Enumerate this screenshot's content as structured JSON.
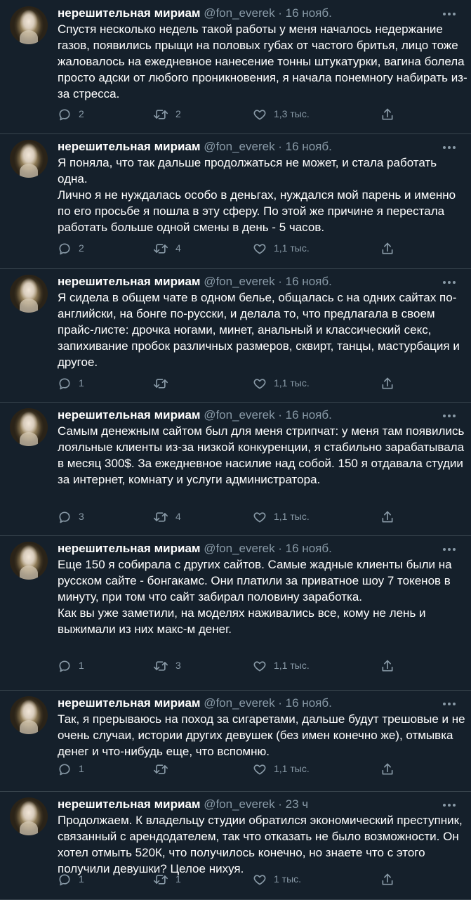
{
  "tweets": [
    {
      "name": "нерешительная мириам",
      "meta": "@fon_everek · 16 нояб.",
      "text": "Спустя несколько недель такой работы у меня началось недержание газов, появились прыщи на половых губах от частого бритья, лицо тоже жаловалось на ежедневное нанесение тонны штукатурки, вагина болела просто адски от любого проникновения, я начала понемногу набирать из-за стресса.",
      "replies": "2",
      "retweets": "2",
      "likes": "1,3 тыс."
    },
    {
      "name": "нерешительная мириам",
      "meta": "@fon_everek · 16 нояб.",
      "text": "Я поняла, что так дальше продолжаться не может, и стала работать одна.\nЛично я не нуждалась особо в деньгах, нуждался мой парень и именно по его просьбе я пошла в эту сферу. По этой же причине я перестала работать больше одной смены в день - 5 часов.",
      "replies": "2",
      "retweets": "4",
      "likes": "1,1 тыс."
    },
    {
      "name": "нерешительная мириам",
      "meta": "@fon_everek · 16 нояб.",
      "text": "Я сидела в общем чате в одном белье, общалась с на одних сайтах по-английски, на бонге по-русски, и делала то, что предлагала в своем прайс-листе: дрочка ногами, минет, анальный и классический секс, запихивание пробок различных размеров, сквирт, танцы, мастурбация и другое.",
      "replies": "1",
      "retweets": "",
      "likes": "1,1 тыс."
    },
    {
      "name": "нерешительная мириам",
      "meta": "@fon_everek · 16 нояб.",
      "text": "Самым денежным сайтом был для меня стрипчат: у меня там появились лояльные клиенты из-за низкой конкуренции, я стабильно зарабатывала в месяц 300$. За  ежедневное насилие над собой. 150 я отдавала студии за интернет, комнату и услуги администратора.",
      "replies": "3",
      "retweets": "4",
      "likes": "1,1 тыс."
    },
    {
      "name": "нерешительная мириам",
      "meta": "@fon_everek · 16 нояб.",
      "text": "Еще 150 я собирала с других сайтов. Самые жадные клиенты были на русском сайте - бонгакамс. Они платили за приватное шоу 7 токенов в минуту, при том что сайт забирал половину заработка.\nКак вы уже заметили, на моделях наживались все, кому не лень и выжимали из них макс-м денег.",
      "replies": "1",
      "retweets": "3",
      "likes": "1,1 тыс."
    },
    {
      "name": "нерешительная мириам",
      "meta": "@fon_everek · 16 нояб.",
      "text": "Так, я прерываюсь на поход за сигаретами, дальше будут трешовые и не очень случаи, истории других девушек (без имен конечно же), отмывка денег и что-нибудь еще, что вспомню.",
      "replies": "1",
      "retweets": "",
      "likes": "1,1 тыс."
    },
    {
      "name": "нерешительная мириам",
      "meta": "@fon_everek · 23 ч",
      "text": "Продолжаем. К владельцу студии обратился экономический преступник, связанный с арендодателем, так что отказать не было возможности. Он хотел отмыть 520К, что получилось конечно, но знаете что с этого получили девушки? Целое нихуя.",
      "replies": "1",
      "retweets": "1",
      "likes": "1 тыс."
    }
  ],
  "icons": {
    "reply": "reply-icon",
    "retweet": "retweet-icon",
    "like": "like-icon",
    "share": "share-icon",
    "more": "more-icon"
  },
  "colors": {
    "background": "#15202b",
    "text": "#ffffff",
    "secondary": "#8899a6",
    "divider": "#38444d"
  }
}
